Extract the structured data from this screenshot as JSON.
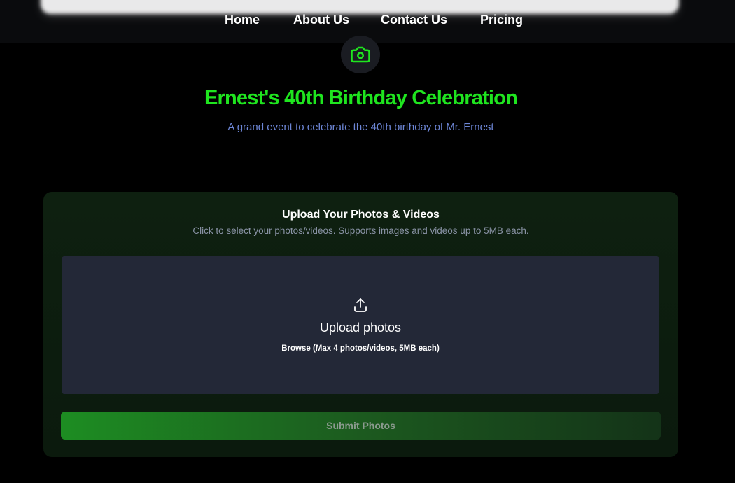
{
  "nav": {
    "items": [
      {
        "label": "Home"
      },
      {
        "label": "About Us"
      },
      {
        "label": "Contact Us"
      },
      {
        "label": "Pricing"
      }
    ]
  },
  "event": {
    "icon": "camera-icon",
    "title": "Ernest's 40th Birthday Celebration",
    "subtitle": "A grand event to celebrate the 40th birthday of Mr. Ernest"
  },
  "upload": {
    "title": "Upload Your Photos & Videos",
    "description": "Click to select your photos/videos. Supports images and videos up to 5MB each.",
    "dropzone_icon": "upload-icon",
    "dropzone_label": "Upload photos",
    "dropzone_hint": "Browse (Max 4 photos/videos, 5MB each)",
    "submit_label": "Submit Photos"
  },
  "colors": {
    "accent_green": "#1fe51f",
    "subtitle_blue": "#6d86d6",
    "background": "#000000",
    "dropzone": "#232837"
  }
}
